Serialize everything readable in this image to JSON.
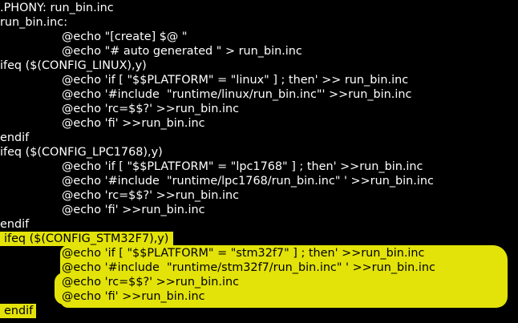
{
  "terminal": {
    "lines": [
      ".PHONY: run_bin.inc",
      "run_bin.inc:",
      "@echo \"[create] $@ \"",
      "@echo \"# auto generated \" > run_bin.inc",
      "ifeq ($(CONFIG_LINUX),y)",
      "@echo 'if [ \"$$PLATFORM\" = \"linux\" ] ; then' >> run_bin.inc",
      "@echo '#include  \"runtime/linux/run_bin.inc\"' >>run_bin.inc",
      "@echo 'rc=$$?' >>run_bin.inc",
      "@echo 'fi' >>run_bin.inc",
      "endif",
      "ifeq ($(CONFIG_LPC1768),y)",
      "@echo 'if [ \"$$PLATFORM\" = \"lpc1768\" ] ; then' >>run_bin.inc",
      "@echo '#include  \"runtime/lpc1768/run_bin.inc\" ' >>run_bin.inc",
      "@echo 'rc=$$?' >>run_bin.inc",
      "@echo 'fi' >>run_bin.inc",
      "endif",
      "ifeq ($(CONFIG_STM32F7),y)",
      "@echo 'if [ \"$$PLATFORM\" = \"stm32f7\" ] ; then' >>run_bin.inc",
      "@echo '#include  \"runtime/stm32f7/run_bin.inc\" ' >>run_bin.inc",
      "@echo 'rc=$$?' >>run_bin.inc",
      "@echo 'fi' >>run_bin.inc",
      "endif"
    ]
  },
  "colors": {
    "background": "#000000",
    "text": "#ffffff",
    "highlight": "#e3e30a",
    "highlighted_text": "#000000"
  }
}
